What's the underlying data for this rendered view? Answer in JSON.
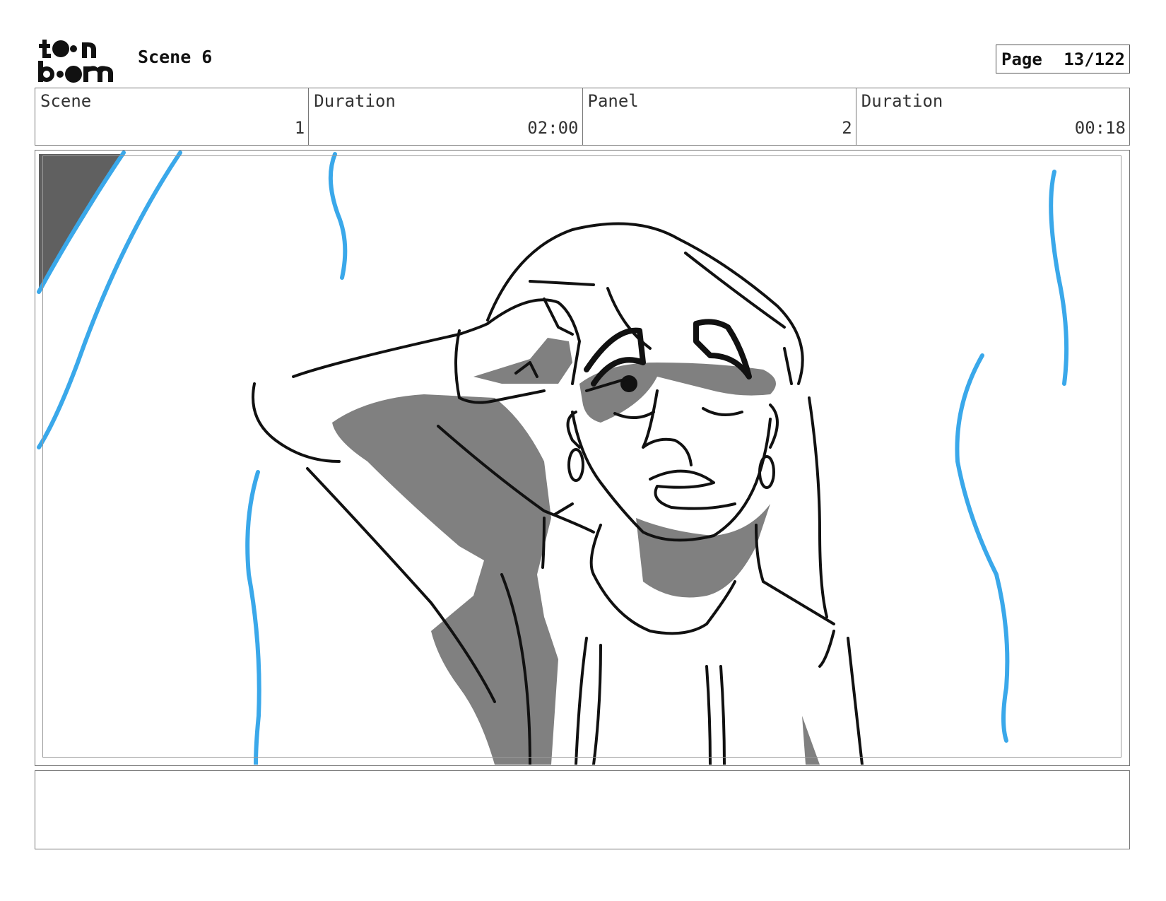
{
  "header": {
    "logo_alt": "toon boom",
    "scene_title": "Scene 6",
    "page_label": "Page",
    "page_value": "13/122"
  },
  "info": {
    "scene_label": "Scene",
    "scene_value": "1",
    "scene_duration_label": "Duration",
    "scene_duration_value": "02:00",
    "panel_label": "Panel",
    "panel_value": "2",
    "panel_duration_label": "Duration",
    "panel_duration_value": "00:18"
  },
  "panel": {
    "image_icon": "storyboard-sketch-image",
    "accent_color": "#3aa8ea",
    "shade_color": "#808080"
  },
  "notes": {
    "text": ""
  }
}
